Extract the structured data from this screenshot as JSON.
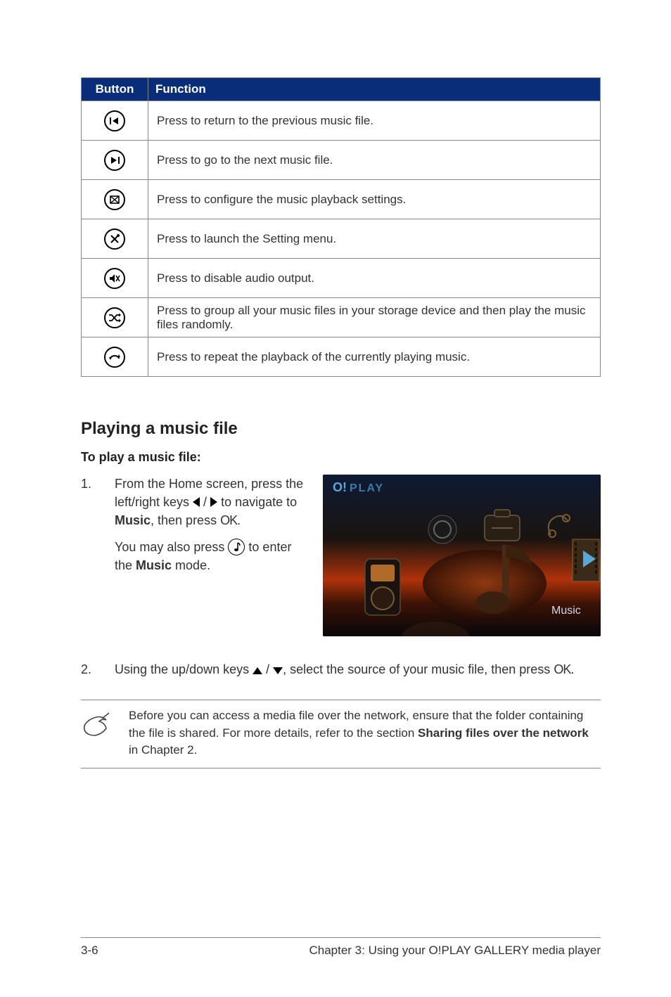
{
  "table": {
    "header_button": "Button",
    "header_function": "Function",
    "rows": [
      {
        "icon": "prev-track-icon",
        "function": "Press to return to the previous music file."
      },
      {
        "icon": "next-track-icon",
        "function": "Press to go to the next music file."
      },
      {
        "icon": "settings-box-icon",
        "function": "Press to configure the music playback settings."
      },
      {
        "icon": "tools-icon",
        "function": "Press to launch the Setting menu."
      },
      {
        "icon": "mute-icon",
        "function": "Press to disable audio output."
      },
      {
        "icon": "shuffle-icon",
        "function": "Press to group all your music files in your storage device and then play the music files randomly."
      },
      {
        "icon": "repeat-icon",
        "function": "Press to repeat the playback of the currently playing music."
      }
    ]
  },
  "section_title": "Playing a music file",
  "subheading": "To play a music file:",
  "steps": {
    "s1": {
      "num": "1.",
      "p1a": "From the Home screen, press the left/right keys ",
      "p1b": " / ",
      "p1c": " to navigate to ",
      "music": "Music",
      "p1d": ", then press ",
      "ok": "OK",
      "p1e": ".",
      "p2a": "You may also press ",
      "p2b": " to enter the ",
      "p2c": " mode."
    },
    "s2": {
      "num": "2.",
      "a": "Using the up/down keys ",
      "b": " / ",
      "c": ", select the source of your music file, then press ",
      "ok": "OK",
      "d": "."
    }
  },
  "screenshot": {
    "brand": "O!PLAY",
    "label": "Music"
  },
  "note": {
    "a": "Before you can access a media file over the network, ensure that the folder containing the file is shared. For more details, refer to the section ",
    "bold": "Sharing files over the network",
    "b": " in Chapter 2."
  },
  "footer": {
    "page": "3-6",
    "chapter": "Chapter 3: Using your O!PLAY GALLERY media player"
  }
}
